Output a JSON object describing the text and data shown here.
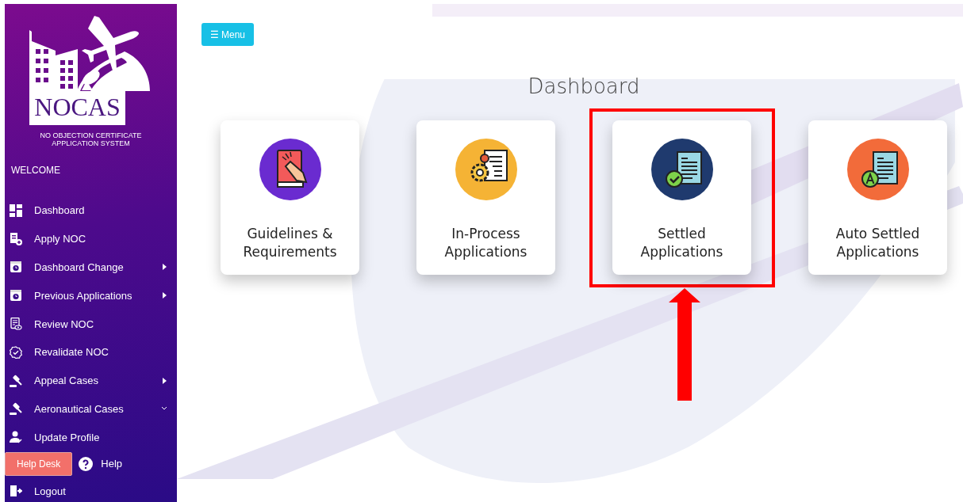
{
  "sidebar": {
    "logo_text": "NOCAS",
    "subtitle_lines": [
      "NO OBJECTION CERTIFICATE",
      "APPLICATION SYSTEM"
    ],
    "welcome": "WELCOME",
    "items": [
      {
        "label": "Dashboard",
        "kind": "grid"
      },
      {
        "label": "Apply NOC",
        "kind": "apply"
      },
      {
        "label": "Dashboard Change",
        "kind": "clock",
        "submenu": true,
        "expanded": false
      },
      {
        "label": "Previous Applications",
        "kind": "clock",
        "submenu": true,
        "expanded": false
      },
      {
        "label": "Review NOC",
        "kind": "review"
      },
      {
        "label": "Revalidate NOC",
        "kind": "badge"
      },
      {
        "label": "Appeal Cases",
        "kind": "gavel",
        "submenu": true,
        "expanded": false
      },
      {
        "label": "Aeronautical Cases",
        "kind": "gavel",
        "submenu": true,
        "expanded": true
      },
      {
        "label": "Update Profile",
        "kind": "user"
      }
    ],
    "help_desk": "Help Desk",
    "help": "Help",
    "logout": "Logout"
  },
  "menu_button": {
    "icon": "☰",
    "label": "Menu"
  },
  "title": "Dashboard",
  "cards": [
    {
      "label": "Guidelines & Requirements",
      "kind": "book",
      "color": "#6a2bd0",
      "highlighted": false
    },
    {
      "label": "In-Process Applications",
      "kind": "gears",
      "color": "#f5b335",
      "highlighted": false
    },
    {
      "label": "Settled Applications",
      "kind": "check",
      "color": "#1f3a6e",
      "highlighted": true
    },
    {
      "label": "Auto Settled Applications",
      "kind": "auto",
      "color": "#f26b3a",
      "highlighted": false
    }
  ]
}
